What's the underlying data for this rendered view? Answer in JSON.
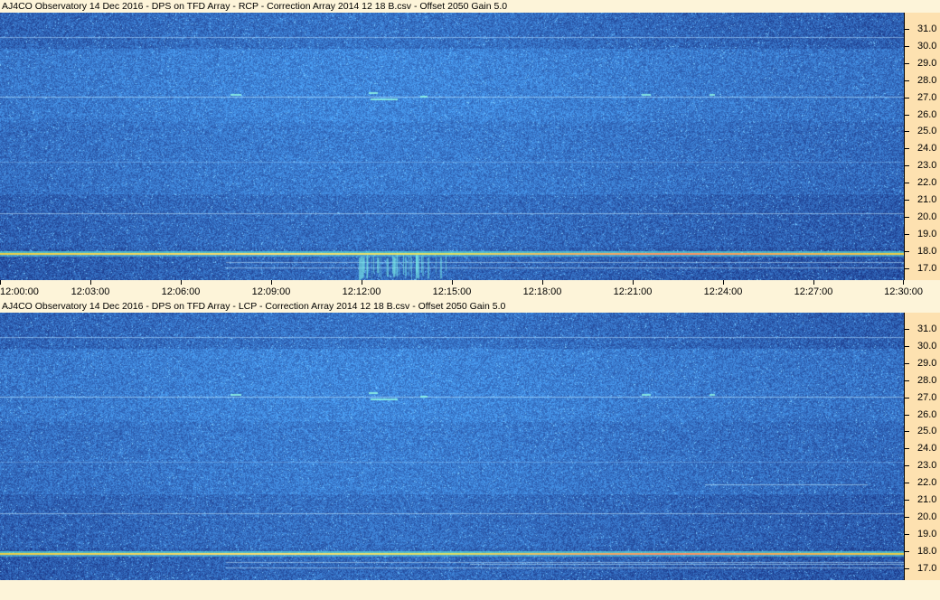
{
  "panels": [
    {
      "title": "AJ4CO Observatory 14 Dec 2016  -  DPS on TFD Array  -  RCP  -  Correction Array 2014 12 18 B.csv  -  Offset 2050  Gain 5.0",
      "polarization": "RCP"
    },
    {
      "title": "AJ4CO Observatory 14 Dec 2016  -  DPS on TFD Array  -  LCP  -  Correction Array 2014 12 18 B.csv  -  Offset 2050  Gain 5.0",
      "polarization": "LCP"
    }
  ],
  "freq_axis": {
    "labels": [
      "31.0",
      "30.0",
      "29.0",
      "28.0",
      "27.0",
      "26.0",
      "25.0",
      "24.0",
      "23.0",
      "22.0",
      "21.0",
      "20.0",
      "19.0",
      "18.0",
      "17.0"
    ]
  },
  "time_axis": {
    "labels": [
      "12:00:00",
      "12:03:00",
      "12:06:00",
      "12:09:00",
      "12:12:00",
      "12:15:00",
      "12:18:00",
      "12:21:00",
      "12:24:00",
      "12:27:00",
      "12:30:00"
    ]
  },
  "colors": {
    "background": "#fde5b4",
    "title_bar": "#fdf4d9",
    "spectrogram_base": "#2848b8",
    "interference_band": "#f0d040"
  }
}
